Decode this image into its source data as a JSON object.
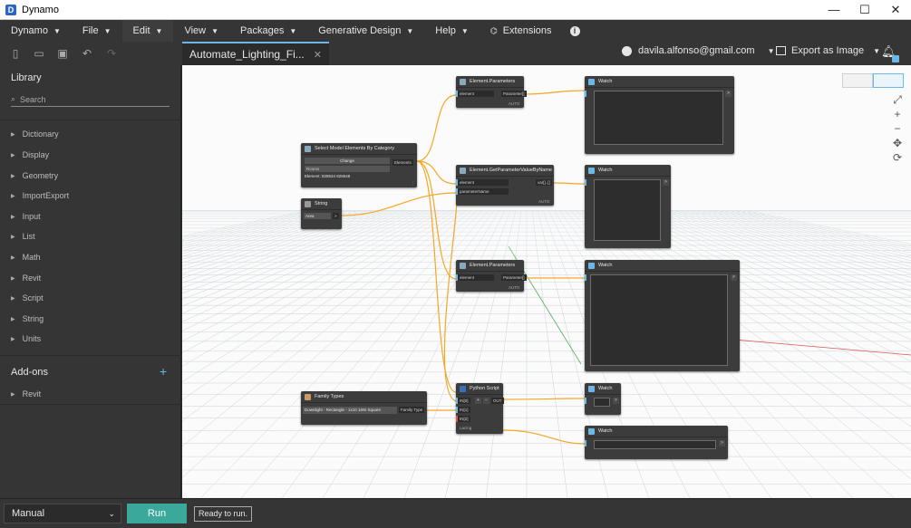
{
  "window": {
    "title": "Dynamo",
    "icon": "dynamo-app-icon",
    "controls": [
      "—",
      "☐",
      "✕"
    ]
  },
  "menu": {
    "items": [
      {
        "label": "Dynamo",
        "caret": "▼"
      },
      {
        "label": "File",
        "caret": "▼"
      },
      {
        "label": "Edit",
        "caret": "▼"
      },
      {
        "label": "View",
        "caret": "▼"
      },
      {
        "label": "Packages",
        "caret": "▼"
      },
      {
        "label": "Generative Design",
        "caret": "▼"
      },
      {
        "label": "Help",
        "caret": "▼"
      },
      {
        "label": "Extensions"
      }
    ],
    "info_icon": "i"
  },
  "toolbar": {
    "tab_label": "Automate_Lighting_Fi...",
    "tab_close": "✕",
    "user_email": "davila.alfonso@gmail.com",
    "export_label": "Export as Image",
    "caret": "▼",
    "bell": "🔔"
  },
  "library": {
    "title": "Library",
    "search_placeholder": "Search",
    "search_icon": "⌕",
    "chevron": "▶",
    "items": [
      "Dictionary",
      "Display",
      "Geometry",
      "ImportExport",
      "Input",
      "List",
      "Math",
      "Revit",
      "Script",
      "String",
      "Units"
    ],
    "addons_title": "Add-ons",
    "addons_plus": "+",
    "addons_items": [
      "Revit"
    ]
  },
  "nodes": {
    "select_model": {
      "title": "Select Model Elements By Category",
      "change": "Change",
      "category": "Rooms",
      "element_text": "Element: 828534 828548",
      "out": "Elements",
      "dots": "⋮"
    },
    "string": {
      "title": "String",
      "value": "Area",
      "out": ">"
    },
    "elem_params_1": {
      "title": "Element.Parameters",
      "in": "element",
      "out": "Parameter[]",
      "footer": "AUTO"
    },
    "elem_get_param": {
      "title": "Element.GetParameterValueByName",
      "in1": "element",
      "in2": "parameterName",
      "out": "var[]..[]",
      "footer": "AUTO"
    },
    "elem_params_2": {
      "title": "Element.Parameters",
      "in": "element",
      "out": "Parameter[]",
      "footer": "AUTO"
    },
    "family_types": {
      "title": "Family Types",
      "value": "Downlight - Rectangle - 1x10 16W Square",
      "out": "Family Type",
      "dots": "⋮"
    },
    "python": {
      "title": "Python Script",
      "in0": "IN[0]",
      "in1": "IN[1]",
      "in2": "IN[2]",
      "out": "OUT",
      "plus": "+",
      "minus": "−",
      "footer": "Lacing"
    },
    "watch_1": {
      "title": "Watch"
    },
    "watch_2": {
      "title": "Watch"
    },
    "watch_3": {
      "title": "Watch"
    },
    "watch_4": {
      "title": "Watch"
    },
    "watch_5": {
      "title": "Watch"
    }
  },
  "canvas": {
    "zoom": [
      "⤢",
      "+",
      "−",
      "✥",
      "⟳"
    ]
  },
  "bottom": {
    "run_mode": "Manual",
    "dropdown": "⌄",
    "run_label": "Run",
    "status": "Ready to run."
  },
  "colors": {
    "accent": "#6ab7e8",
    "wire": "#f5a623",
    "run": "#3aa99b"
  }
}
